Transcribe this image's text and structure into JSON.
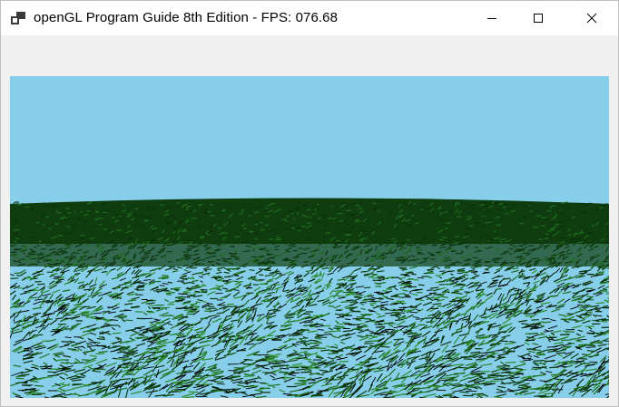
{
  "window": {
    "title": "openGL Program Guide 8th Edition - FPS: 076.68",
    "icon": "app-window-icon",
    "controls": {
      "minimize": "minimize-icon",
      "maximize": "maximize-icon",
      "close": "close-icon"
    }
  },
  "scene": {
    "sky_color": "#87ceeb",
    "grass_dark": "#0f3d0f",
    "grass_mid": "#1f6b1f",
    "grass_light": "#2e8b2e"
  }
}
